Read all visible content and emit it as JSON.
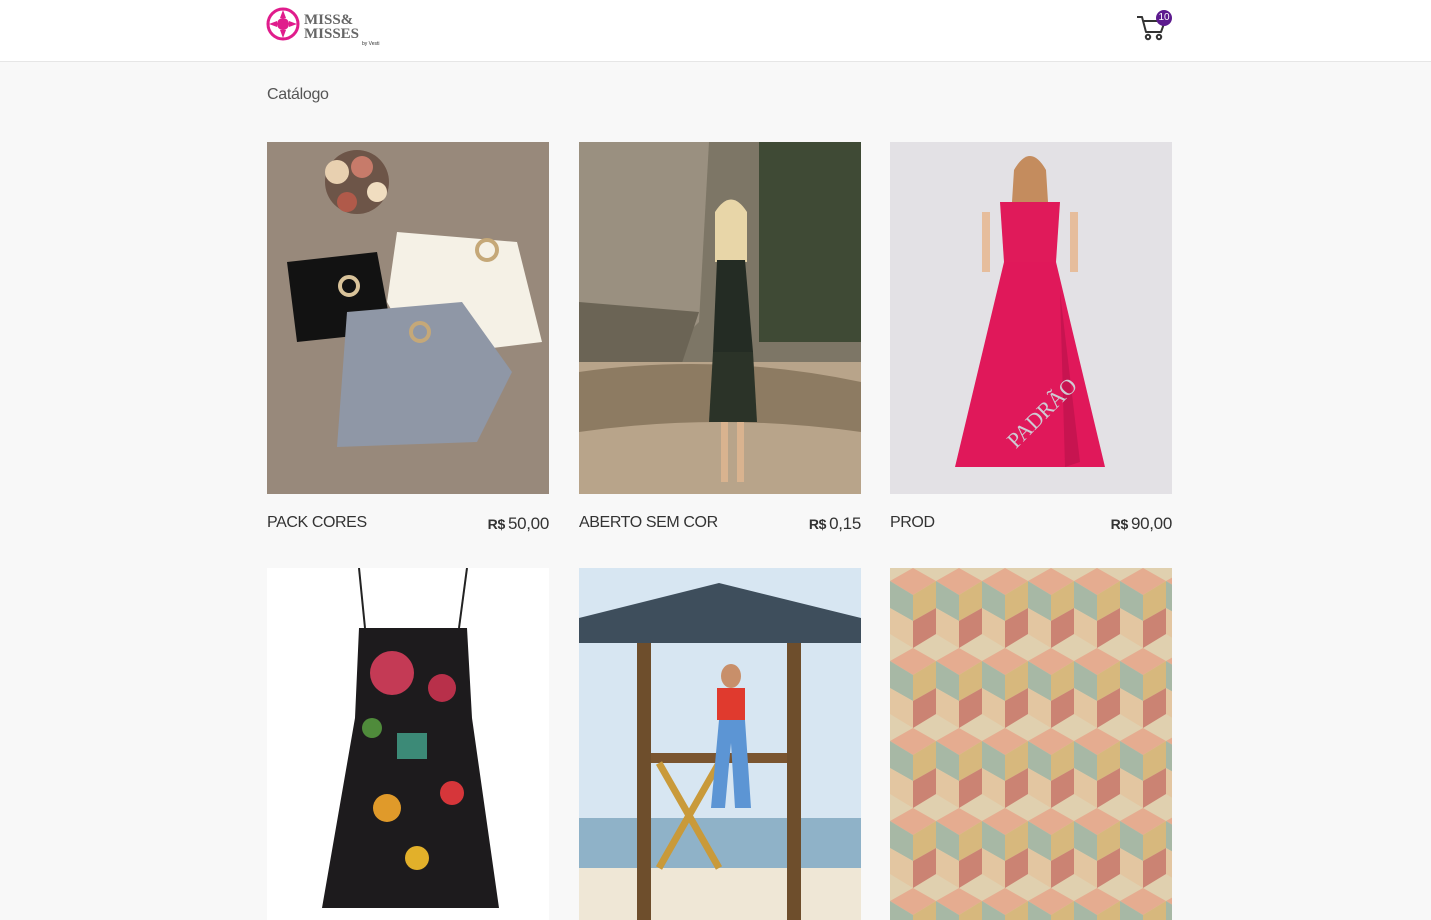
{
  "header": {
    "logo_text_line1": "MISS&",
    "logo_text_line2": "MISSES",
    "logo_byline": "by Vesti",
    "cart_count": "10",
    "accent_color": "#5c1a8e",
    "logo_color": "#e01c8c"
  },
  "page": {
    "title": "Catálogo"
  },
  "products": [
    {
      "name": "PACK CORES",
      "currency": "R$",
      "price": "50,00",
      "image": "shorts-flatlay"
    },
    {
      "name": "ABERTO SEM COR",
      "currency": "R$",
      "price": "0,15",
      "image": "model-dress-tree"
    },
    {
      "name": "PROD",
      "currency": "R$",
      "price": "90,00",
      "image": "red-gown"
    },
    {
      "name": "",
      "currency": "",
      "price": "",
      "image": "floral-dress"
    },
    {
      "name": "",
      "currency": "",
      "price": "",
      "image": "beach-hut-model"
    },
    {
      "name": "",
      "currency": "",
      "price": "",
      "image": "geometric-pattern"
    }
  ]
}
